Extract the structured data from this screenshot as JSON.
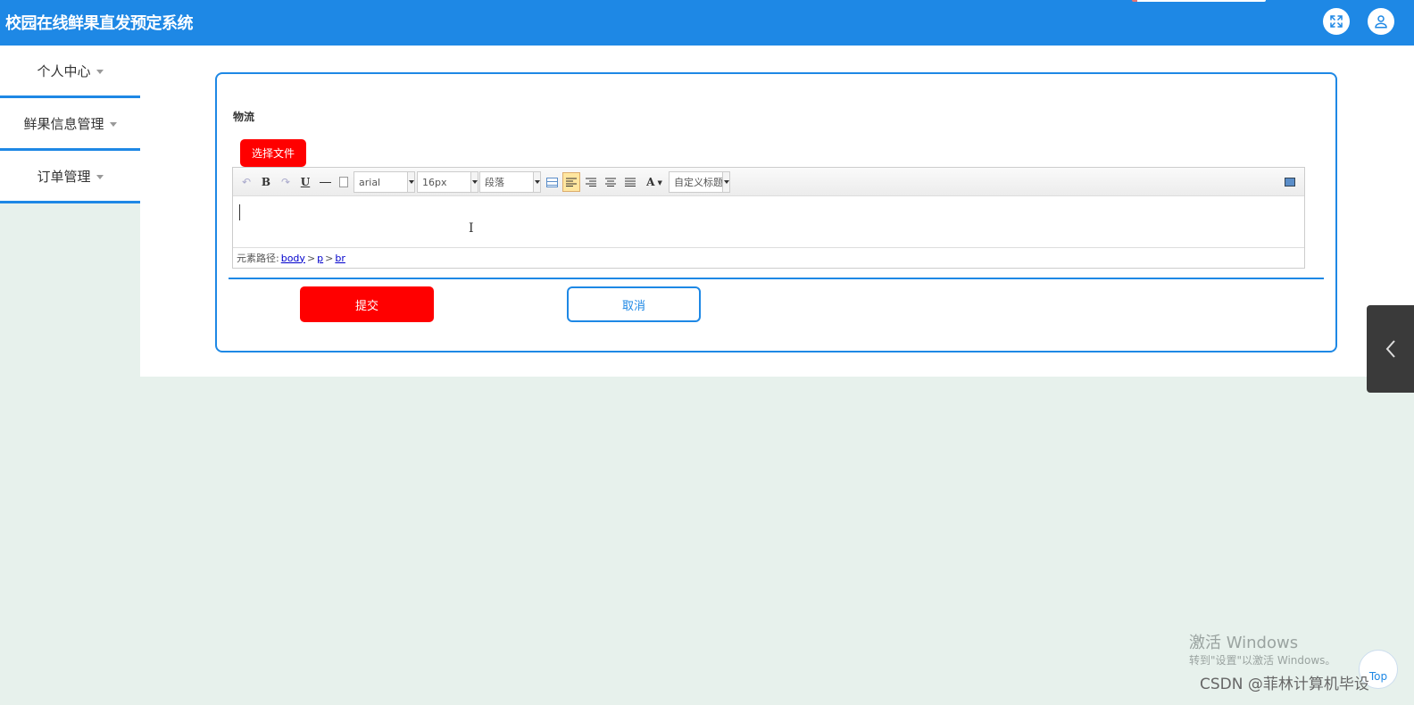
{
  "header": {
    "title": "校园在线鲜果直发预定系统"
  },
  "sidebar": {
    "items": [
      {
        "label": "个人中心"
      },
      {
        "label": "鲜果信息管理"
      },
      {
        "label": "订单管理"
      }
    ]
  },
  "form": {
    "field_label": "物流",
    "choose_file": "选择文件",
    "editor": {
      "font_family": "arial",
      "font_size": "16px",
      "paragraph": "段落",
      "custom_title": "自定义标题",
      "path_label": "元素路径:",
      "path": [
        "body",
        "p",
        "br"
      ],
      "path_separator": ">"
    },
    "submit": "提交",
    "cancel": "取消"
  },
  "overlay": {
    "watermark_title": "激活 Windows",
    "watermark_sub": "转到\"设置\"以激活 Windows。",
    "csdn": "CSDN @菲林计算机毕设",
    "top_button": "Top"
  },
  "colors": {
    "primary": "#1e88e5",
    "danger": "#ff0000",
    "page_bg": "#e7f1ec"
  }
}
